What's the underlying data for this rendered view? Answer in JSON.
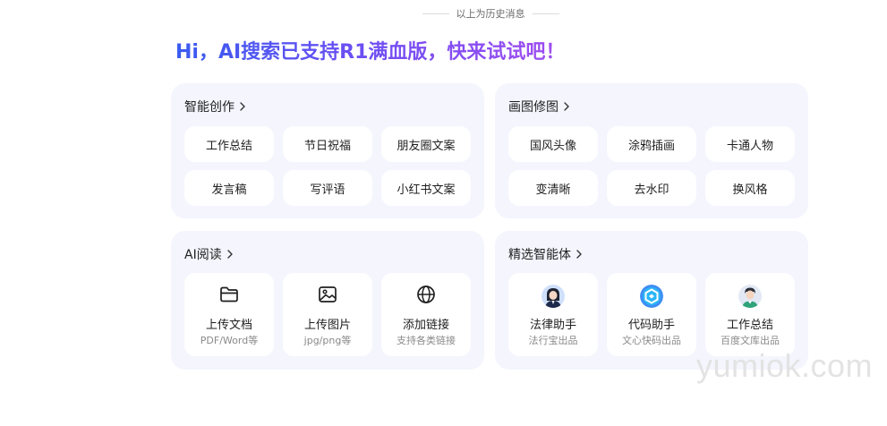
{
  "history_divider": {
    "text": "以上为历史消息"
  },
  "headline": "Hi，AI搜索已支持R1满血版，快来试试吧！",
  "panels": {
    "create": {
      "title": "智能创作",
      "chips": [
        "工作总结",
        "节日祝福",
        "朋友圈文案",
        "发言稿",
        "写评语",
        "小红书文案"
      ]
    },
    "image": {
      "title": "画图修图",
      "chips": [
        "国风头像",
        "涂鸦插画",
        "卡通人物",
        "变清晰",
        "去水印",
        "换风格"
      ]
    },
    "read": {
      "title": "AI阅读",
      "cards": [
        {
          "name": "上传文档",
          "sub": "PDF/Word等",
          "icon": "folder-icon"
        },
        {
          "name": "上传图片",
          "sub": "jpg/png等",
          "icon": "image-icon"
        },
        {
          "name": "添加链接",
          "sub": "支持各类链接",
          "icon": "globe-icon"
        }
      ]
    },
    "agents": {
      "title": "精选智能体",
      "cards": [
        {
          "name": "法律助手",
          "sub": "法行宝出品",
          "icon": "lawyer-avatar-icon"
        },
        {
          "name": "代码助手",
          "sub": "文心快码出品",
          "icon": "code-logo-icon"
        },
        {
          "name": "工作总结",
          "sub": "百度文库出品",
          "icon": "worker-avatar-icon"
        }
      ]
    }
  },
  "watermark": "yumiok.com",
  "colors": {
    "panel_bg": "#f4f5fd",
    "headline_start": "#3a5cf0",
    "headline_end": "#a24df0"
  }
}
